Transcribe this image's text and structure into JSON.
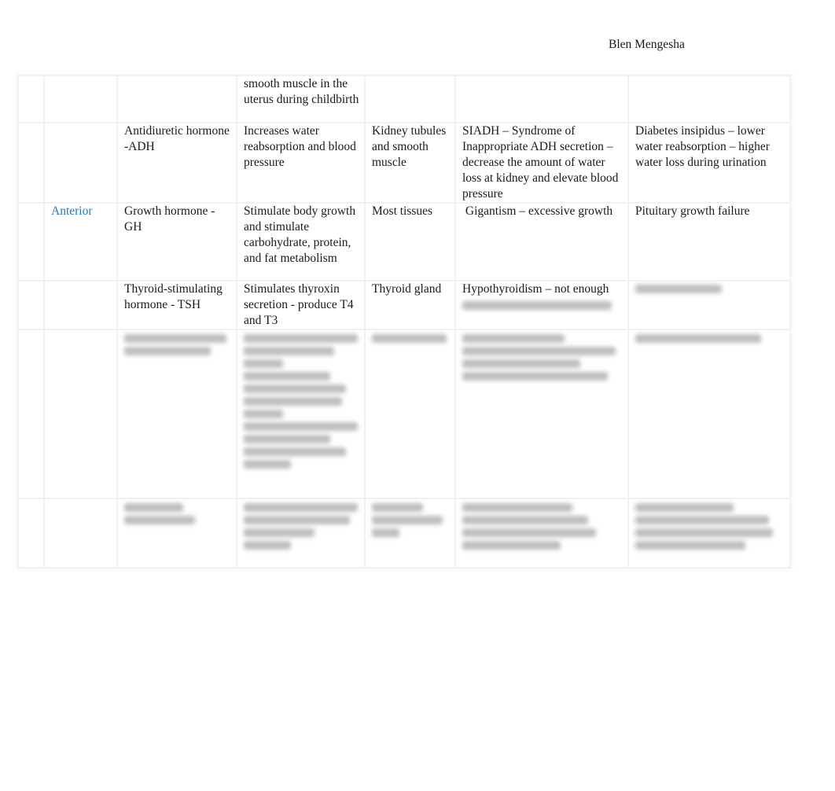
{
  "header": {
    "author": "Blen Mengesha"
  },
  "table": {
    "rows": [
      {
        "region": "",
        "hormone": "",
        "function": "smooth muscle in the uterus during childbirth",
        "target": "",
        "hyper": "",
        "hypo": "",
        "obscured": false
      },
      {
        "region": "",
        "hormone": "Antidiuretic hormone -ADH",
        "function": "Increases water reabsorption and blood pressure",
        "target": "Kidney tubules and smooth muscle",
        "hyper": "SIADH – Syndrome of Inappropriate ADH secretion – decrease the amount of water loss at kidney and elevate blood pressure",
        "hypo": "Diabetes insipidus – lower water reabsorption – higher water loss during urination",
        "obscured": false
      },
      {
        "region": "Anterior",
        "hormone": "Growth hormone - GH",
        "function": "Stimulate body growth and stimulate carbohydrate, protein, and fat metabolism",
        "target": "Most tissues",
        "hyper": " Gigantism – excessive growth",
        "hypo": "Pituitary growth failure",
        "obscured": false
      },
      {
        "region": "",
        "hormone": "Thyroid-stimulating hormone - TSH",
        "function": "Stimulates thyroxin secretion - produce T4 and T3",
        "target": "Thyroid gland",
        "hyper": "Hypothyroidism – not enough",
        "hypo": "",
        "obscured": false
      },
      {
        "obscured": true
      },
      {
        "obscured": true
      }
    ]
  }
}
